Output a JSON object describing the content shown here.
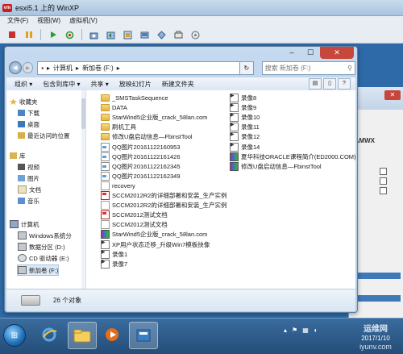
{
  "host": {
    "title": "esxi5.1 上的 WinXP",
    "menu": [
      "文件(F)",
      "视图(W)",
      "虚拟机(V)"
    ]
  },
  "bg_window": {
    "title": "-AMWX",
    "close": "✕"
  },
  "explorer": {
    "address": {
      "segments": [
        "计算机",
        "新加卷 (F:)"
      ],
      "separator": "▸"
    },
    "search_placeholder": "搜索 新加卷 (F:)",
    "commands": [
      "组织 ▾",
      "包含到库中 ▾",
      "共享 ▾",
      "放映幻灯片",
      "新建文件夹"
    ],
    "nav": [
      {
        "label": "收藏夹",
        "icon": "star-icon"
      },
      {
        "label": "下载",
        "icon": "download-folder-icon"
      },
      {
        "label": "桌面",
        "icon": "desktop-icon"
      },
      {
        "label": "最近访问的位置",
        "icon": "recent-places-icon"
      },
      {
        "label": "库",
        "icon": "library-icon"
      },
      {
        "label": "视频",
        "icon": "video-library-icon"
      },
      {
        "label": "图片",
        "icon": "pictures-library-icon"
      },
      {
        "label": "文档",
        "icon": "documents-library-icon"
      },
      {
        "label": "音乐",
        "icon": "music-library-icon"
      },
      {
        "label": "计算机",
        "icon": "computer-icon"
      },
      {
        "label": "Windows系统分",
        "icon": "windows-drive-icon"
      },
      {
        "label": "数据分区 (D:)",
        "icon": "drive-icon"
      },
      {
        "label": "CD 驱动器 (E:)",
        "icon": "cd-drive-icon"
      },
      {
        "label": "新加卷 (F:)",
        "icon": "drive-icon"
      }
    ],
    "files_col1": [
      {
        "name": "_SMSTaskSequence",
        "type": "folder"
      },
      {
        "name": "DATA",
        "type": "folder"
      },
      {
        "name": "StarWind5企业版_crack_58lan.com",
        "type": "folder"
      },
      {
        "name": "刷机工具",
        "type": "folder"
      },
      {
        "name": "修改U盘启动信息—FbinstTool",
        "type": "folder"
      },
      {
        "name": "QQ图片20161122160953",
        "type": "image"
      },
      {
        "name": "QQ图片20161122161426",
        "type": "image"
      },
      {
        "name": "QQ图片20161122162345",
        "type": "image"
      },
      {
        "name": "QQ图片20161122162349",
        "type": "image"
      },
      {
        "name": "recovery",
        "type": "doc"
      },
      {
        "name": "SCCM2012R2的详细部署和安装_生产实例",
        "type": "pdf"
      },
      {
        "name": "SCCM2012R2的详细部署和安装_生产实例",
        "type": "doc"
      },
      {
        "name": "SCCM2012测试文档",
        "type": "pdf"
      },
      {
        "name": "SCCM2012测试文档",
        "type": "doc"
      },
      {
        "name": "StarWind5企业版_crack_58lan.com",
        "type": "rar"
      },
      {
        "name": "XP用户状态迁移_升级Win7模板抉像",
        "type": "mp4"
      },
      {
        "name": "录像1",
        "type": "mp4"
      },
      {
        "name": "录像7",
        "type": "mp4"
      }
    ],
    "files_col2": [
      {
        "name": "录像8",
        "type": "mp4"
      },
      {
        "name": "录像9",
        "type": "mp4"
      },
      {
        "name": "录像10",
        "type": "mp4"
      },
      {
        "name": "录像11",
        "type": "mp4"
      },
      {
        "name": "录像12",
        "type": "mp4"
      },
      {
        "name": "录像14",
        "type": "mp4"
      },
      {
        "name": "夏华科技ORACLE课程简介(ED2000.COM)",
        "type": "rar"
      },
      {
        "name": "修改U盘启动信息—FbinstTool",
        "type": "rar"
      }
    ],
    "status": "26 个对象"
  },
  "taskbar": {
    "clock_date": "2017/1/10",
    "watermark_text": "运维网",
    "watermark_url": "iyunv.com"
  }
}
